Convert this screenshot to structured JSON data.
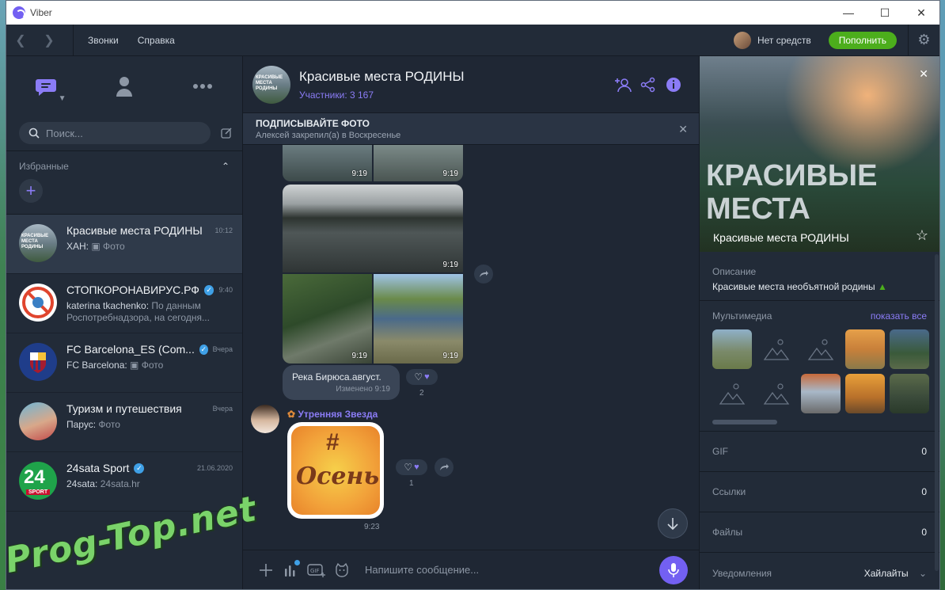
{
  "window": {
    "title": "Viber"
  },
  "menubar": {
    "items": [
      "Звонки",
      "Справка"
    ],
    "balance": "Нет средств",
    "topup": "Пополнить"
  },
  "search": {
    "placeholder": "Поиск..."
  },
  "favorites": {
    "label": "Избранные"
  },
  "chats": [
    {
      "name": "Красивые места РОДИНЫ",
      "time": "10:12",
      "who": "ХАН:",
      "preview": "Фото",
      "verified": false
    },
    {
      "name": "СТОПКОРОНАВИРУС.РФ",
      "time": "9:40",
      "who": "katerina tkachenko:",
      "preview": "По данным Роспотребнадзора, на сегодня...",
      "verified": true
    },
    {
      "name": "FC Barcelona_ES (Com...",
      "time": "Вчера",
      "who": "FC Barcelona:",
      "preview": "Фото",
      "verified": true
    },
    {
      "name": "Туризм и путешествия",
      "time": "Вчера",
      "who": "Парус:",
      "preview": "Фото",
      "verified": false
    },
    {
      "name": "24sata Sport",
      "time": "21.06.2020",
      "who": "24sata:",
      "preview": "24sata.hr",
      "verified": true
    }
  ],
  "header": {
    "title": "Красивые места РОДИНЫ",
    "participants": "Участники: 3 167",
    "avatar_text": "КРАСИВЫЕ МЕСТА РОДИНЫ"
  },
  "pinned": {
    "title": "ПОДПИСЫВАЙТЕ ФОТО",
    "subtitle": "Алексей закрепил(а) в Воскресенье"
  },
  "messages": {
    "photo_time": "9:19",
    "caption": "Река Бирюса.август.",
    "edited": "Изменено 9:19",
    "reaction_count_1": "2",
    "sender": "Утренняя Звезда",
    "sticker_top": "#",
    "sticker_word": "Осень",
    "sticker_time": "9:23",
    "reaction_count_2": "1"
  },
  "composer": {
    "placeholder": "Напишите сообщение..."
  },
  "info": {
    "cover_big_line1": "КРАСИВЫЕ",
    "cover_big_line2": "МЕСТА",
    "cover_name": "Красивые места РОДИНЫ",
    "desc_label": "Описание",
    "desc_text": "Красивые места необъятной родины",
    "media_label": "Мультимедиа",
    "media_show_all": "показать все",
    "gif_label": "GIF",
    "gif_count": "0",
    "links_label": "Ссылки",
    "links_count": "0",
    "files_label": "Файлы",
    "files_count": "0",
    "notif_label": "Уведомления",
    "notif_value": "Хайлайты"
  },
  "watermark": "Prog-Top.net",
  "colors": {
    "accent": "#7360f2",
    "topup": "#4cae1c",
    "bg": "#1f2734"
  }
}
